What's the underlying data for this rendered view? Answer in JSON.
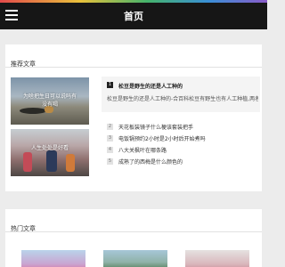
{
  "header": {
    "title": "首页",
    "menu_icon": "menu-icon"
  },
  "recommend": {
    "heading": "推荐文章",
    "thumbs": [
      {
        "caption_line1": "为啥把生日可以说吗有",
        "caption_line2": "没有喝"
      },
      {
        "caption_line1": "人生处处是好看"
      }
    ],
    "featured": {
      "rank": "1",
      "title": "松豆是野生的还是人工种的",
      "excerpt": "松豆是野生的还是人工种的-合百科松豆有野生也有人工种植,两者区别在..."
    },
    "list": [
      {
        "rank": "2",
        "title": "天花板装镜子什么梗该套装把手"
      },
      {
        "rank": "3",
        "title": "电饭锅预约2小时是2小时后开始煮吗"
      },
      {
        "rank": "4",
        "title": "八大关枫叶在哪条路"
      },
      {
        "rank": "5",
        "title": "成熟了的西梅是什么颜色的"
      }
    ]
  },
  "hot": {
    "heading": "热门文章"
  },
  "colors": {
    "header_bg": "#161616",
    "page_bg": "#ececec",
    "badge_active": "#222222"
  }
}
